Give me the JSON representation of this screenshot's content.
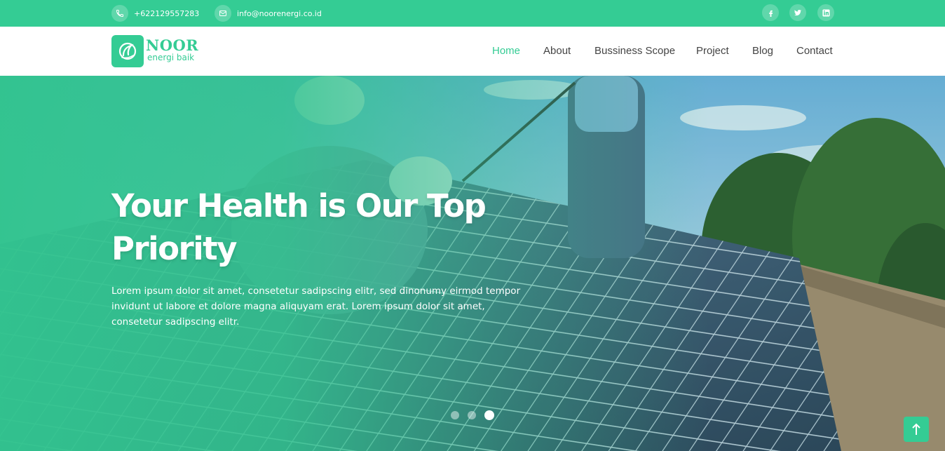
{
  "topbar": {
    "phone": "+622129557283",
    "email": "info@noorenergi.co.id",
    "phone_icon": "phone-icon",
    "email_icon": "mail-icon",
    "social": [
      "facebook-icon",
      "twitter-icon",
      "linkedin-icon"
    ]
  },
  "brand": {
    "name": "NOOR",
    "tagline": "energi baik"
  },
  "nav": {
    "items": [
      "Home",
      "About",
      "Bussiness Scope",
      "Project",
      "Blog",
      "Contact"
    ],
    "active": "Home"
  },
  "hero": {
    "title": "Your Health is Our Top Priority",
    "text": "Lorem ipsum dolor sit amet, consetetur sadipscing elitr, sed dinonumy eirmod tempor invidunt ut labore et dolore magna aliquyam erat. Lorem ipsum dolor sit amet, consetetur sadipscing elitr.",
    "slides_total": 3,
    "slide_active": 3
  },
  "colors": {
    "brand": "#34cc94",
    "nav_text": "#444444",
    "white": "#ffffff"
  },
  "back_to_top_icon": "arrow-up-icon"
}
